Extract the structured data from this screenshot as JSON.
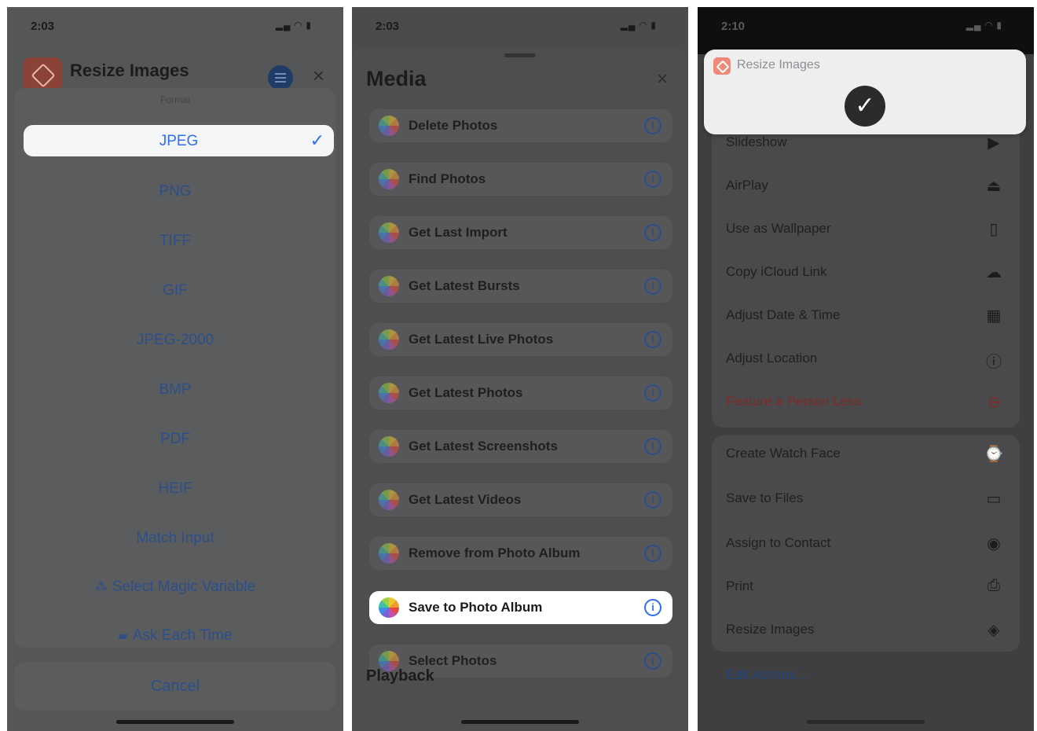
{
  "panel1": {
    "status_time": "2:03",
    "app_title": "Resize Images",
    "format_label": "Format",
    "selected_format": "JPEG",
    "formats": [
      "PNG",
      "TIFF",
      "GIF",
      "JPEG-2000",
      "BMP",
      "PDF",
      "HEIF",
      "Match Input"
    ],
    "magic_variable": "Select Magic Variable",
    "ask_each_time": "Ask Each Time",
    "cancel": "Cancel"
  },
  "panel2": {
    "status_time": "2:03",
    "title": "Media",
    "actions": [
      "Delete Photos",
      "Find Photos",
      "Get Last Import",
      "Get Latest Bursts",
      "Get Latest Live Photos",
      "Get Latest Photos",
      "Get Latest Screenshots",
      "Get Latest Videos",
      "Remove from Photo Album",
      "Save to Photo Album",
      "Select Photos"
    ],
    "highlighted_action": "Save to Photo Album",
    "next_section": "Playback"
  },
  "panel3": {
    "status_time": "2:10",
    "banner_title": "Resize Images",
    "group1": [
      "Slideshow",
      "AirPlay",
      "Use as Wallpaper",
      "Copy iCloud Link",
      "Adjust Date & Time",
      "Adjust Location",
      "Feature a Person Less"
    ],
    "group2": [
      "Create Watch Face",
      "Save to Files",
      "Assign to Contact",
      "Print",
      "Resize Images"
    ],
    "edit_actions": "Edit Actions..."
  },
  "colors": {
    "accent_blue": "#2f6ff0",
    "destructive_red": "#7f2a27"
  }
}
